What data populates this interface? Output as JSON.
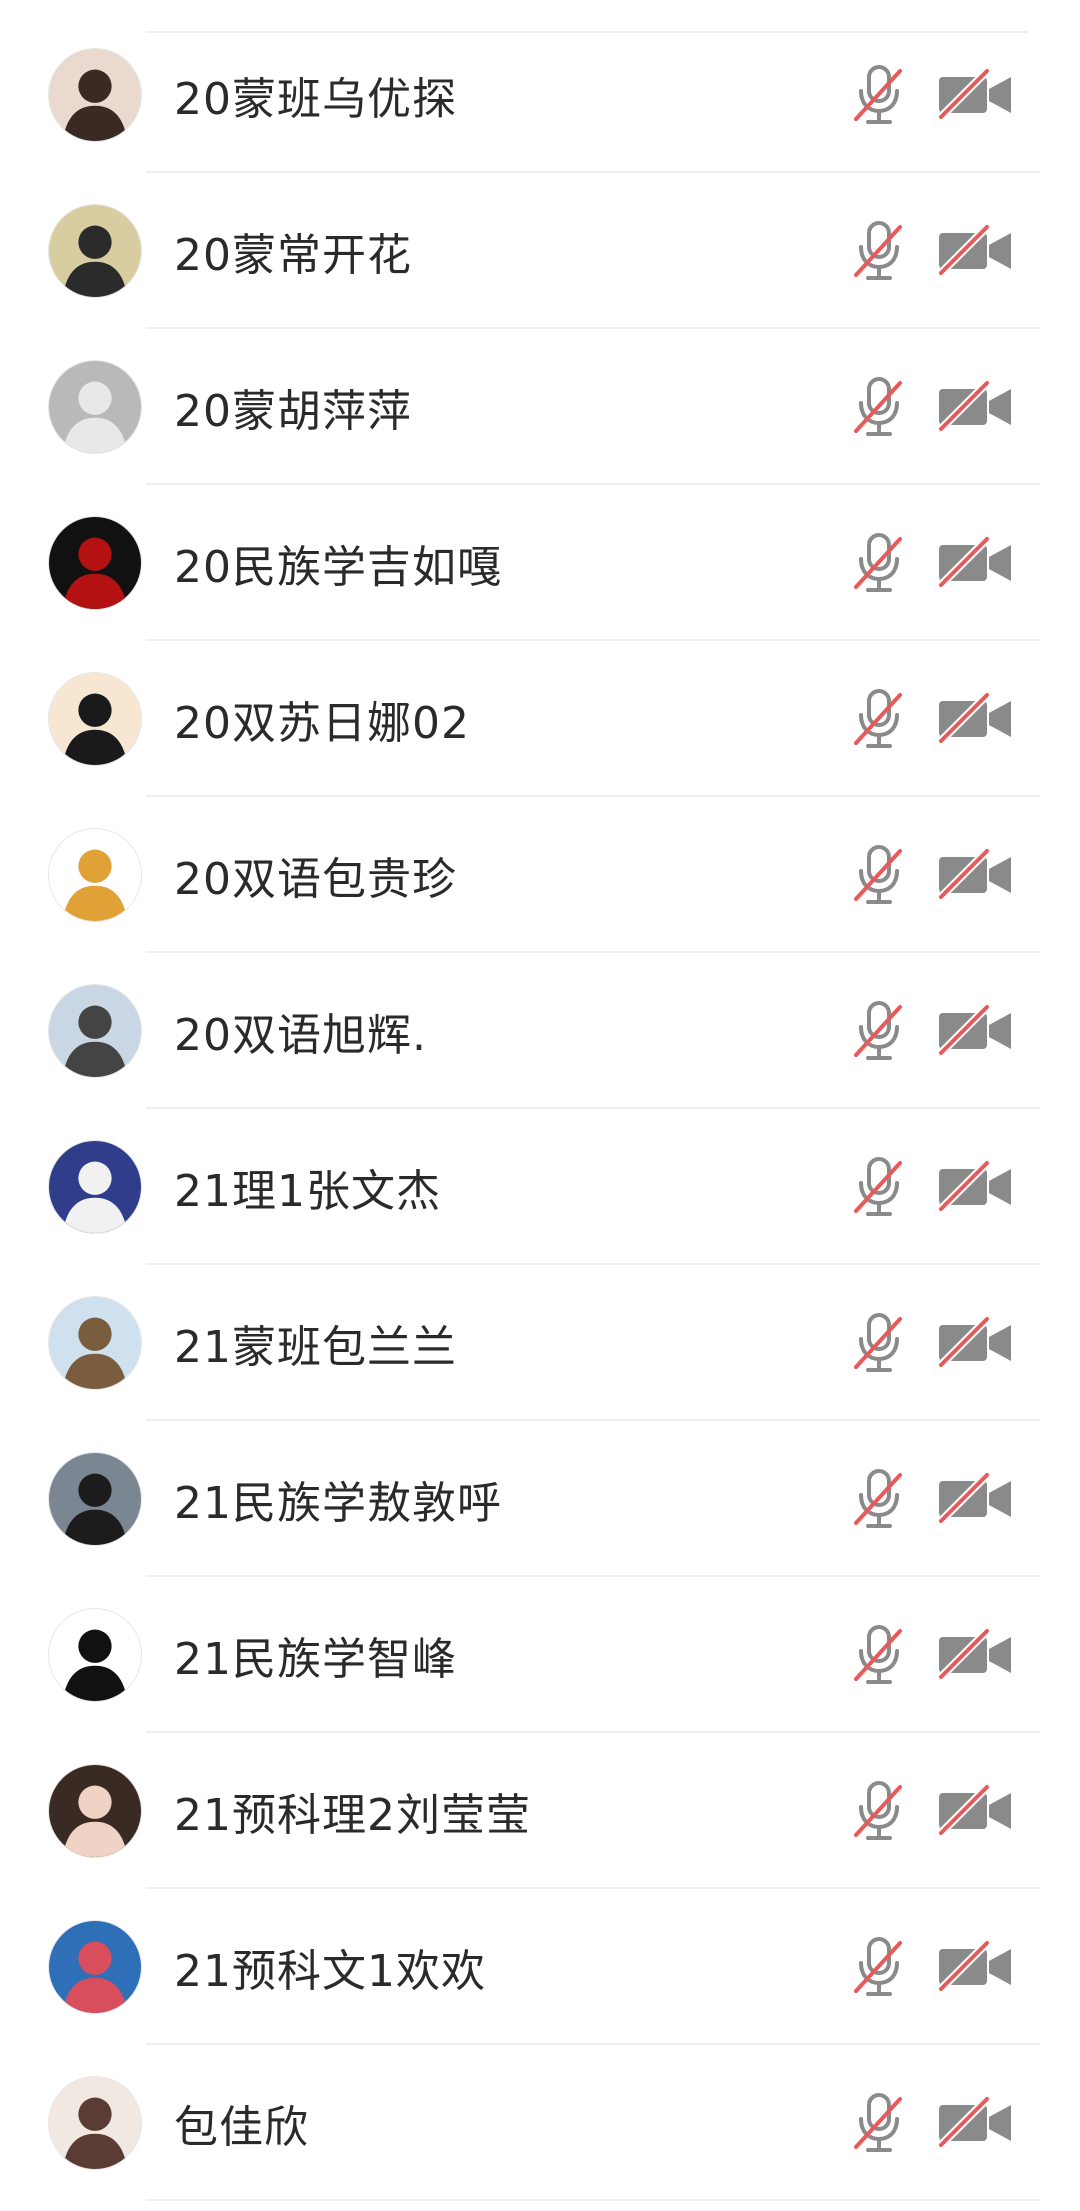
{
  "participants": [
    {
      "name": "20蒙班乌优探",
      "avatar": {
        "bg": "#e9d9cf",
        "fg": "#3a2a24"
      }
    },
    {
      "name": "20蒙常开花",
      "avatar": {
        "bg": "#d8cda0",
        "fg": "#2b2b2b"
      }
    },
    {
      "name": "20蒙胡萍萍",
      "avatar": {
        "bg": "#b9b9b9",
        "fg": "#e8e8e8"
      }
    },
    {
      "name": "20民族学吉如嘎",
      "avatar": {
        "bg": "#111111",
        "fg": "#b41212"
      }
    },
    {
      "name": "20双苏日娜02",
      "avatar": {
        "bg": "#f6e6d2",
        "fg": "#1a1a1a"
      }
    },
    {
      "name": "20双语包贵珍",
      "avatar": {
        "bg": "#ffffff",
        "fg": "#e0a136"
      }
    },
    {
      "name": "20双语旭辉.",
      "avatar": {
        "bg": "#c9d6e3",
        "fg": "#444444"
      }
    },
    {
      "name": "21理1张文杰",
      "avatar": {
        "bg": "#2f3d8a",
        "fg": "#f1f1f1"
      }
    },
    {
      "name": "21蒙班包兰兰",
      "avatar": {
        "bg": "#cfe0ef",
        "fg": "#7a5c3e"
      }
    },
    {
      "name": "21民族学敖敦呼",
      "avatar": {
        "bg": "#7a8691",
        "fg": "#1c1c1c"
      }
    },
    {
      "name": "21民族学智峰",
      "avatar": {
        "bg": "#ffffff",
        "fg": "#111111"
      }
    },
    {
      "name": "21预科理2刘莹莹",
      "avatar": {
        "bg": "#3a2a24",
        "fg": "#f0d3c5"
      }
    },
    {
      "name": "21预科文1欢欢",
      "avatar": {
        "bg": "#2f6fb8",
        "fg": "#d94e5d"
      }
    },
    {
      "name": "包佳欣",
      "avatar": {
        "bg": "#f2e8e2",
        "fg": "#5a3c34"
      }
    }
  ],
  "icons": {
    "mic": "mic-muted-icon",
    "camera": "camera-off-icon"
  },
  "colors": {
    "icon_gray": "#8a8a8a",
    "slash_red": "#e85a5a",
    "divider": "#efefef"
  }
}
